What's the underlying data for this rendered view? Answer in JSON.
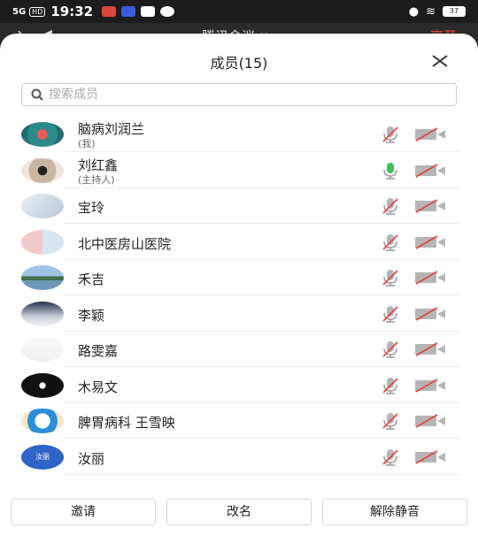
{
  "status_bar": {
    "signal": "5G",
    "hd": "HD",
    "time": "19:32",
    "battery": "37"
  },
  "background_header": {
    "title": "腾讯会议 ∨",
    "right_action": "离开"
  },
  "panel": {
    "title": "成员(15)",
    "close_icon": "close-icon"
  },
  "search": {
    "placeholder": "搜索成员"
  },
  "members": [
    {
      "name": "脑病刘润兰",
      "sub": "(我)",
      "avatar": "avatar-teal",
      "mic": "muted",
      "camera": "off"
    },
    {
      "name": "刘红鑫",
      "sub": "(主持人)",
      "avatar": "avatar-eye",
      "mic": "active",
      "camera": "off"
    },
    {
      "name": "宝玲",
      "sub": "",
      "avatar": "avatar-cartoon",
      "mic": "muted",
      "camera": "off"
    },
    {
      "name": "北中医房山医院",
      "sub": "",
      "avatar": "avatar-couple",
      "mic": "muted",
      "camera": "off"
    },
    {
      "name": "禾吉",
      "sub": "",
      "avatar": "avatar-lake",
      "mic": "muted",
      "camera": "off"
    },
    {
      "name": "李颖",
      "sub": "",
      "avatar": "avatar-bride",
      "mic": "muted",
      "camera": "off"
    },
    {
      "name": "路雯嘉",
      "sub": "",
      "avatar": "avatar-calligraphy",
      "mic": "muted",
      "camera": "off"
    },
    {
      "name": "木易文",
      "sub": "",
      "avatar": "avatar-dark",
      "mic": "muted",
      "camera": "off"
    },
    {
      "name": "脾胃病科 王雪映",
      "sub": "",
      "avatar": "avatar-doraemon",
      "mic": "muted",
      "camera": "off"
    },
    {
      "name": "汝丽",
      "sub": "",
      "avatar": "avatar-blue",
      "avatar_text": "汝丽",
      "mic": "muted",
      "camera": "off"
    }
  ],
  "actions": {
    "invite": "邀请",
    "rename": "改名",
    "unmute": "解除静音"
  },
  "colors": {
    "mic_active": "#3cc15a",
    "muted_strike": "#e0453b",
    "icon_gray": "#b5b5b5"
  }
}
